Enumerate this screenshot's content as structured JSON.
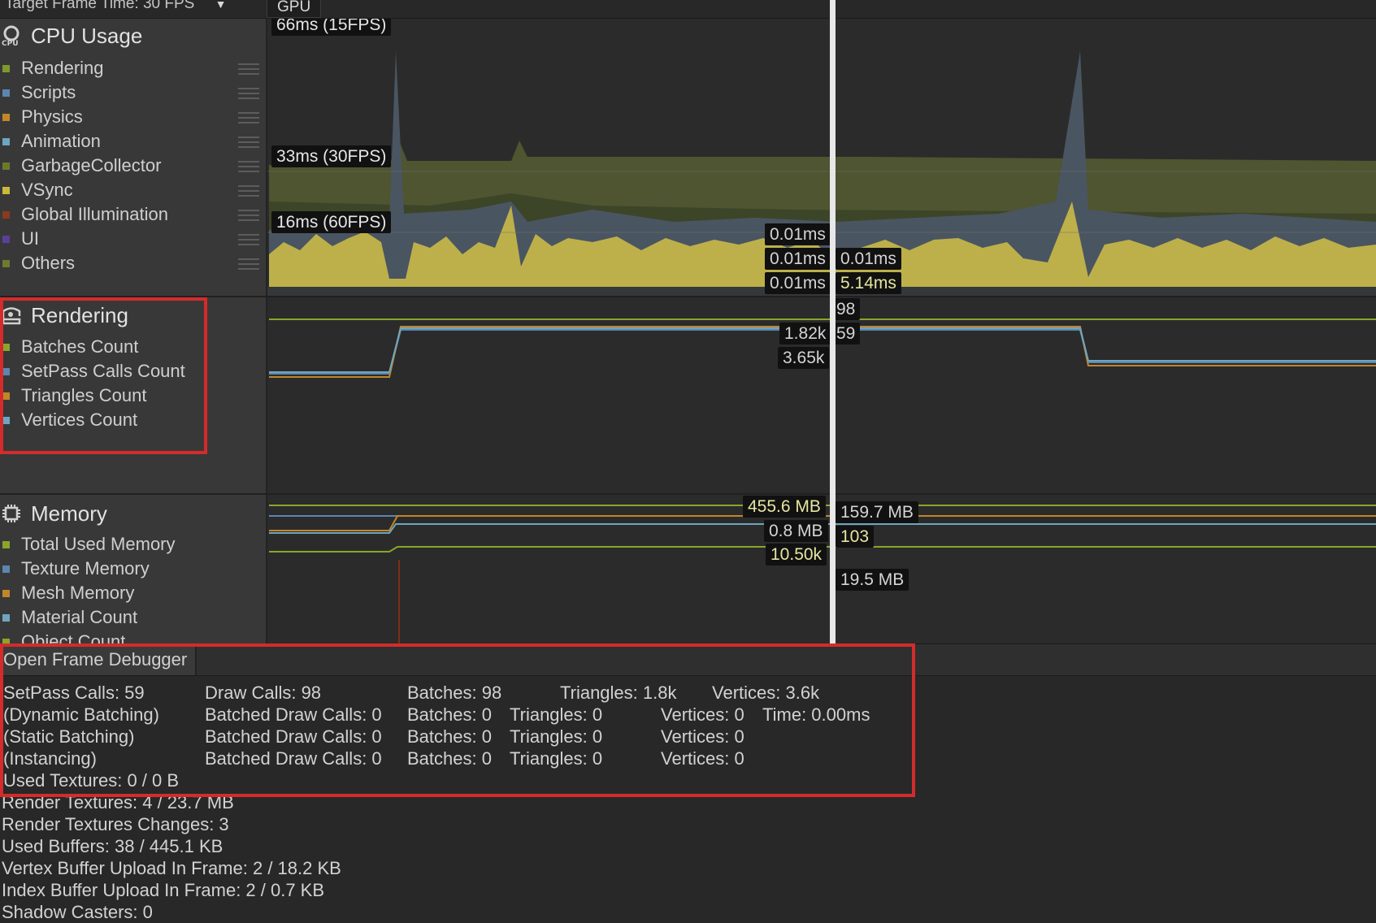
{
  "topbar": {
    "target_frame_label": "Target Frame Time: 30 FPS",
    "gpu_tab": "GPU"
  },
  "cpu": {
    "title": "CPU Usage",
    "icon": "cpu-icon",
    "legend": [
      {
        "name": "Rendering",
        "color": "#7f9a2a"
      },
      {
        "name": "Scripts",
        "color": "#5b86b0"
      },
      {
        "name": "Physics",
        "color": "#c2862a"
      },
      {
        "name": "Animation",
        "color": "#6ea6bf"
      },
      {
        "name": "GarbageCollector",
        "color": "#6b7a2a"
      },
      {
        "name": "VSync",
        "color": "#c9b93a"
      },
      {
        "name": "Global Illumination",
        "color": "#8a3a1e"
      },
      {
        "name": "UI",
        "color": "#5a3f9a"
      },
      {
        "name": "Others",
        "color": "#6f7a30"
      }
    ],
    "guides": [
      "66ms (15FPS)",
      "33ms (30FPS)",
      "16ms (60FPS)"
    ],
    "cursor_labels_left": [
      "0.01ms",
      "0.01ms",
      "0.01ms"
    ],
    "cursor_labels_right": [
      "0.01ms",
      "5.14ms"
    ]
  },
  "rendering": {
    "title": "Rendering",
    "icon": "rendering-icon",
    "legend": [
      {
        "name": "Batches Count",
        "color": "#8aa62a"
      },
      {
        "name": "SetPass Calls Count",
        "color": "#5b86b0"
      },
      {
        "name": "Triangles Count",
        "color": "#c2862a"
      },
      {
        "name": "Vertices Count",
        "color": "#6ea6bf"
      }
    ],
    "cursor_labels_left": [
      "1.82k",
      "3.65k"
    ],
    "cursor_labels_right": [
      "98",
      "59"
    ]
  },
  "memory": {
    "title": "Memory",
    "icon": "chip-icon",
    "legend": [
      {
        "name": "Total Used Memory",
        "color": "#8aa62a"
      },
      {
        "name": "Texture Memory",
        "color": "#5b86b0"
      },
      {
        "name": "Mesh Memory",
        "color": "#c2862a"
      },
      {
        "name": "Material Count",
        "color": "#6ea6bf"
      },
      {
        "name": "Object Count",
        "color": "#8aa62a"
      }
    ],
    "cursor_labels_left": [
      "455.6 MB",
      "0.8 MB",
      "10.50k"
    ],
    "cursor_labels_right": [
      "159.7 MB",
      "103",
      "19.5 MB"
    ]
  },
  "details": {
    "open_frame_debugger": "Open Frame Debugger",
    "rows": [
      [
        "SetPass Calls: 59",
        "Draw Calls: 98",
        "Batches: 98",
        "Triangles: 1.8k",
        "Vertices: 3.6k"
      ],
      [
        "(Dynamic Batching)",
        "Batched Draw Calls: 0",
        "Batches: 0",
        "Triangles: 0",
        "Vertices: 0",
        "Time: 0.00ms"
      ],
      [
        "(Static Batching)",
        "Batched Draw Calls: 0",
        "Batches: 0",
        "Triangles: 0",
        "Vertices: 0"
      ],
      [
        "(Instancing)",
        "Batched Draw Calls: 0",
        "Batches: 0",
        "Triangles: 0",
        "Vertices: 0"
      ]
    ],
    "lines": [
      "Used Textures: 0 / 0 B",
      "Render Textures: 4 / 23.7 MB",
      "Render Textures Changes: 3",
      "Used Buffers: 38 / 445.1 KB",
      "Vertex Buffer Upload In Frame: 2 / 18.2 KB",
      "Index Buffer Upload In Frame: 2 / 0.7 KB",
      "Shadow Casters: 0"
    ]
  },
  "highlight_color": "#d52b2b"
}
